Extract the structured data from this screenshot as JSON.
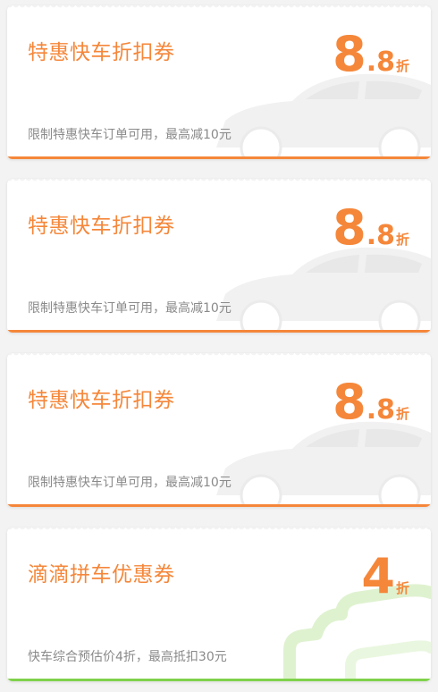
{
  "colors": {
    "orange": "#f5873a",
    "green": "#7fd24b",
    "background": "#f3f3f3",
    "description_gray": "#8a8a8a"
  },
  "coupons": [
    {
      "title": "特惠快车折扣券",
      "discount_int": "8",
      "discount_dec": ".8",
      "discount_unit": "折",
      "description": "限制特惠快车订单可用，最高减10元",
      "accent": "orange",
      "decoration_icon": "car-silhouette-icon"
    },
    {
      "title": "特惠快车折扣券",
      "discount_int": "8",
      "discount_dec": ".8",
      "discount_unit": "折",
      "description": "限制特惠快车订单可用，最高减10元",
      "accent": "orange",
      "decoration_icon": "car-silhouette-icon"
    },
    {
      "title": "特惠快车折扣券",
      "discount_int": "8",
      "discount_dec": ".8",
      "discount_unit": "折",
      "description": "限制特惠快车订单可用，最高减10元",
      "accent": "orange",
      "decoration_icon": "car-silhouette-icon"
    },
    {
      "title": "滴滴拼车优惠券",
      "discount_int": "4",
      "discount_dec": "",
      "discount_unit": "折",
      "description": "快车综合预估价4折，最高抵扣30元",
      "accent": "green",
      "decoration_icon": "carpool-outline-icon"
    }
  ]
}
